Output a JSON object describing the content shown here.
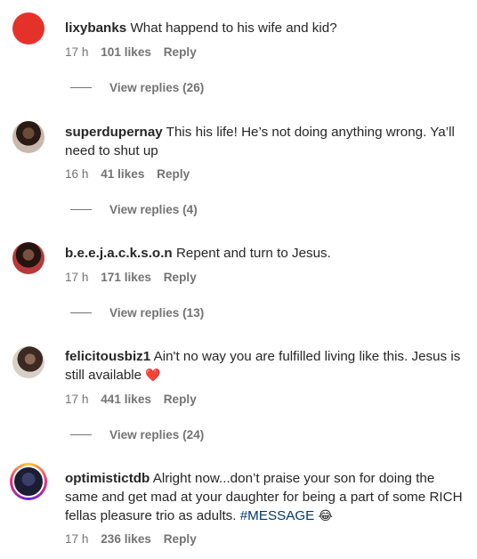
{
  "comments": [
    {
      "username": "lixybanks",
      "text": "What happend to his wife and kid?",
      "time": "17 h",
      "likes": "101 likes",
      "reply": "Reply",
      "view_replies": "View replies (26)"
    },
    {
      "username": "superdupernay",
      "text": "This his life! He’s not doing anything wrong. Ya’ll need to shut up",
      "time": "16 h",
      "likes": "41 likes",
      "reply": "Reply",
      "view_replies": "View replies (4)"
    },
    {
      "username": "b.e.e.j.a.c.k.s.o.n",
      "text": "Repent and turn to Jesus.",
      "time": "17 h",
      "likes": "171 likes",
      "reply": "Reply",
      "view_replies": "View replies (13)"
    },
    {
      "username": "felicitousbiz1",
      "text": "Ain't no way you are fulfilled living like this. Jesus is still available",
      "emoji": "❤️",
      "time": "17 h",
      "likes": "441 likes",
      "reply": "Reply",
      "view_replies": "View replies (24)"
    },
    {
      "username": "optimistictdb",
      "text": "Alright now...don’t praise your son for doing the same and get mad at your daughter for being a part of some RICH fellas pleasure trio as adults.",
      "hashtag": "#MESSAGE",
      "emoji": "😂",
      "time": "17 h",
      "likes": "236 likes",
      "reply": "Reply"
    }
  ],
  "colors": {
    "text": "#262626",
    "muted": "#737373",
    "hashtag": "#00376b",
    "avatar_red": "#e4322b"
  },
  "icons": {
    "heart": "red-heart-icon",
    "laugh": "tears-of-joy-icon"
  }
}
